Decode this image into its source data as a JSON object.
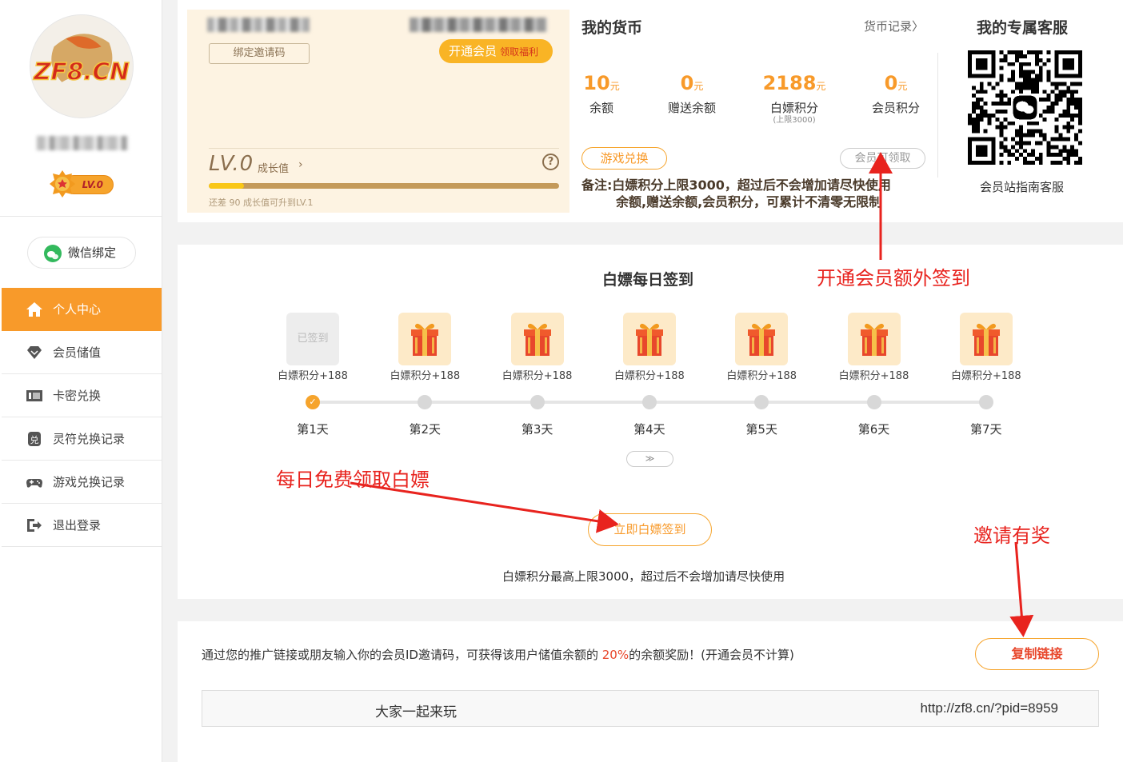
{
  "sidebar": {
    "logo_text": "ZF8.CN",
    "level_badge": "LV.0",
    "wechat_bind": "微信绑定",
    "menu": [
      {
        "label": "个人中心",
        "icon": "home-icon",
        "active": true
      },
      {
        "label": "会员储值",
        "icon": "diamond-icon",
        "active": false
      },
      {
        "label": "卡密兑换",
        "icon": "ticket-icon",
        "active": false
      },
      {
        "label": "灵符兑换记录",
        "icon": "exchange-icon",
        "active": false
      },
      {
        "label": "游戏兑换记录",
        "icon": "gamepad-icon",
        "active": false
      },
      {
        "label": "退出登录",
        "icon": "logout-icon",
        "active": false
      }
    ]
  },
  "member_card": {
    "bind_invite_label": "绑定邀请码",
    "vip_label": "开通会员",
    "vip_sub": "领取福利",
    "level": "LV.0",
    "growth_label": "成长值",
    "growth_arrow": "›",
    "help": "?",
    "progress_fraction": 0.1,
    "progress_note": "还差 90 成长值可升到LV.1"
  },
  "currency": {
    "title": "我的货币",
    "record_link": "货币记录〉",
    "unit": "元",
    "items": [
      {
        "value": "10",
        "label": "余额",
        "sub": ""
      },
      {
        "value": "0",
        "label": "赠送余额",
        "sub": ""
      },
      {
        "value": "2188",
        "label": "白嫖积分",
        "sub": "(上限3000)"
      },
      {
        "value": "0",
        "label": "会员积分",
        "sub": ""
      }
    ],
    "game_exchange": "游戏兑换",
    "vip_claim": "会员可领取",
    "note_line1": "备注:白嫖积分上限3000，超过后不会增加请尽快使用",
    "note_line2": "余额,赠送余额,会员积分，可累计不清零无限制"
  },
  "service": {
    "title": "我的专属客服",
    "name": "会员站指南客服"
  },
  "signin": {
    "title": "白嫖每日签到",
    "days": [
      {
        "label": "第1天",
        "reward": "白嫖积分+188",
        "done": true,
        "done_text": "已签到"
      },
      {
        "label": "第2天",
        "reward": "白嫖积分+188",
        "done": false
      },
      {
        "label": "第3天",
        "reward": "白嫖积分+188",
        "done": false
      },
      {
        "label": "第4天",
        "reward": "白嫖积分+188",
        "done": false
      },
      {
        "label": "第5天",
        "reward": "白嫖积分+188",
        "done": false
      },
      {
        "label": "第6天",
        "reward": "白嫖积分+188",
        "done": false
      },
      {
        "label": "第7天",
        "reward": "白嫖积分+188",
        "done": false
      }
    ],
    "expand": "≫",
    "button": "立即白嫖签到",
    "note": "白嫖积分最高上限3000，超过后不会增加请尽快使用"
  },
  "invite": {
    "text_before": "通过您的推广链接或朋友输入你的会员ID邀请码，可获得该用户储值余额的 ",
    "percent": "20%",
    "text_after": "的余额奖励！(开通会员不计算)",
    "copy_button": "复制链接",
    "share_text": "大家一起来玩",
    "link": "http://zf8.cn/?pid=8959"
  },
  "annotations": {
    "vip_extra": "开通会员额外签到",
    "daily_free": "每日免费领取白嫖",
    "invite_reward": "邀请有奖"
  },
  "colors": {
    "accent": "#f89a2a",
    "annotation": "#e8231e"
  }
}
